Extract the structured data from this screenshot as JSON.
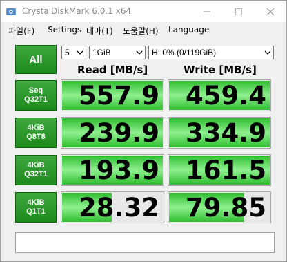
{
  "window": {
    "title": "CrystalDiskMark 6.0.1 x64"
  },
  "menu": [
    "파일(F)",
    "Settings",
    "테마(T)",
    "도움말(H)",
    "Language"
  ],
  "controls": {
    "all_label": "All",
    "count": "5",
    "size": "1GiB",
    "drive": "H: 0% (0/119GiB)"
  },
  "headers": {
    "read": "Read [MB/s]",
    "write": "Write [MB/s]"
  },
  "rows": [
    {
      "line1": "Seq",
      "line2": "Q32T1",
      "read": "557.9",
      "write": "459.4",
      "read_fill": 1.0,
      "write_fill": 1.0
    },
    {
      "line1": "4KiB",
      "line2": "Q8T8",
      "read": "239.9",
      "write": "334.9",
      "read_fill": 1.0,
      "write_fill": 1.0
    },
    {
      "line1": "4KiB",
      "line2": "Q32T1",
      "read": "193.9",
      "write": "161.5",
      "read_fill": 1.0,
      "write_fill": 1.0
    },
    {
      "line1": "4KiB",
      "line2": "Q1T1",
      "read": "28.32",
      "write": "79.85",
      "read_fill": 0.5,
      "write_fill": 0.75
    }
  ],
  "comment": ""
}
